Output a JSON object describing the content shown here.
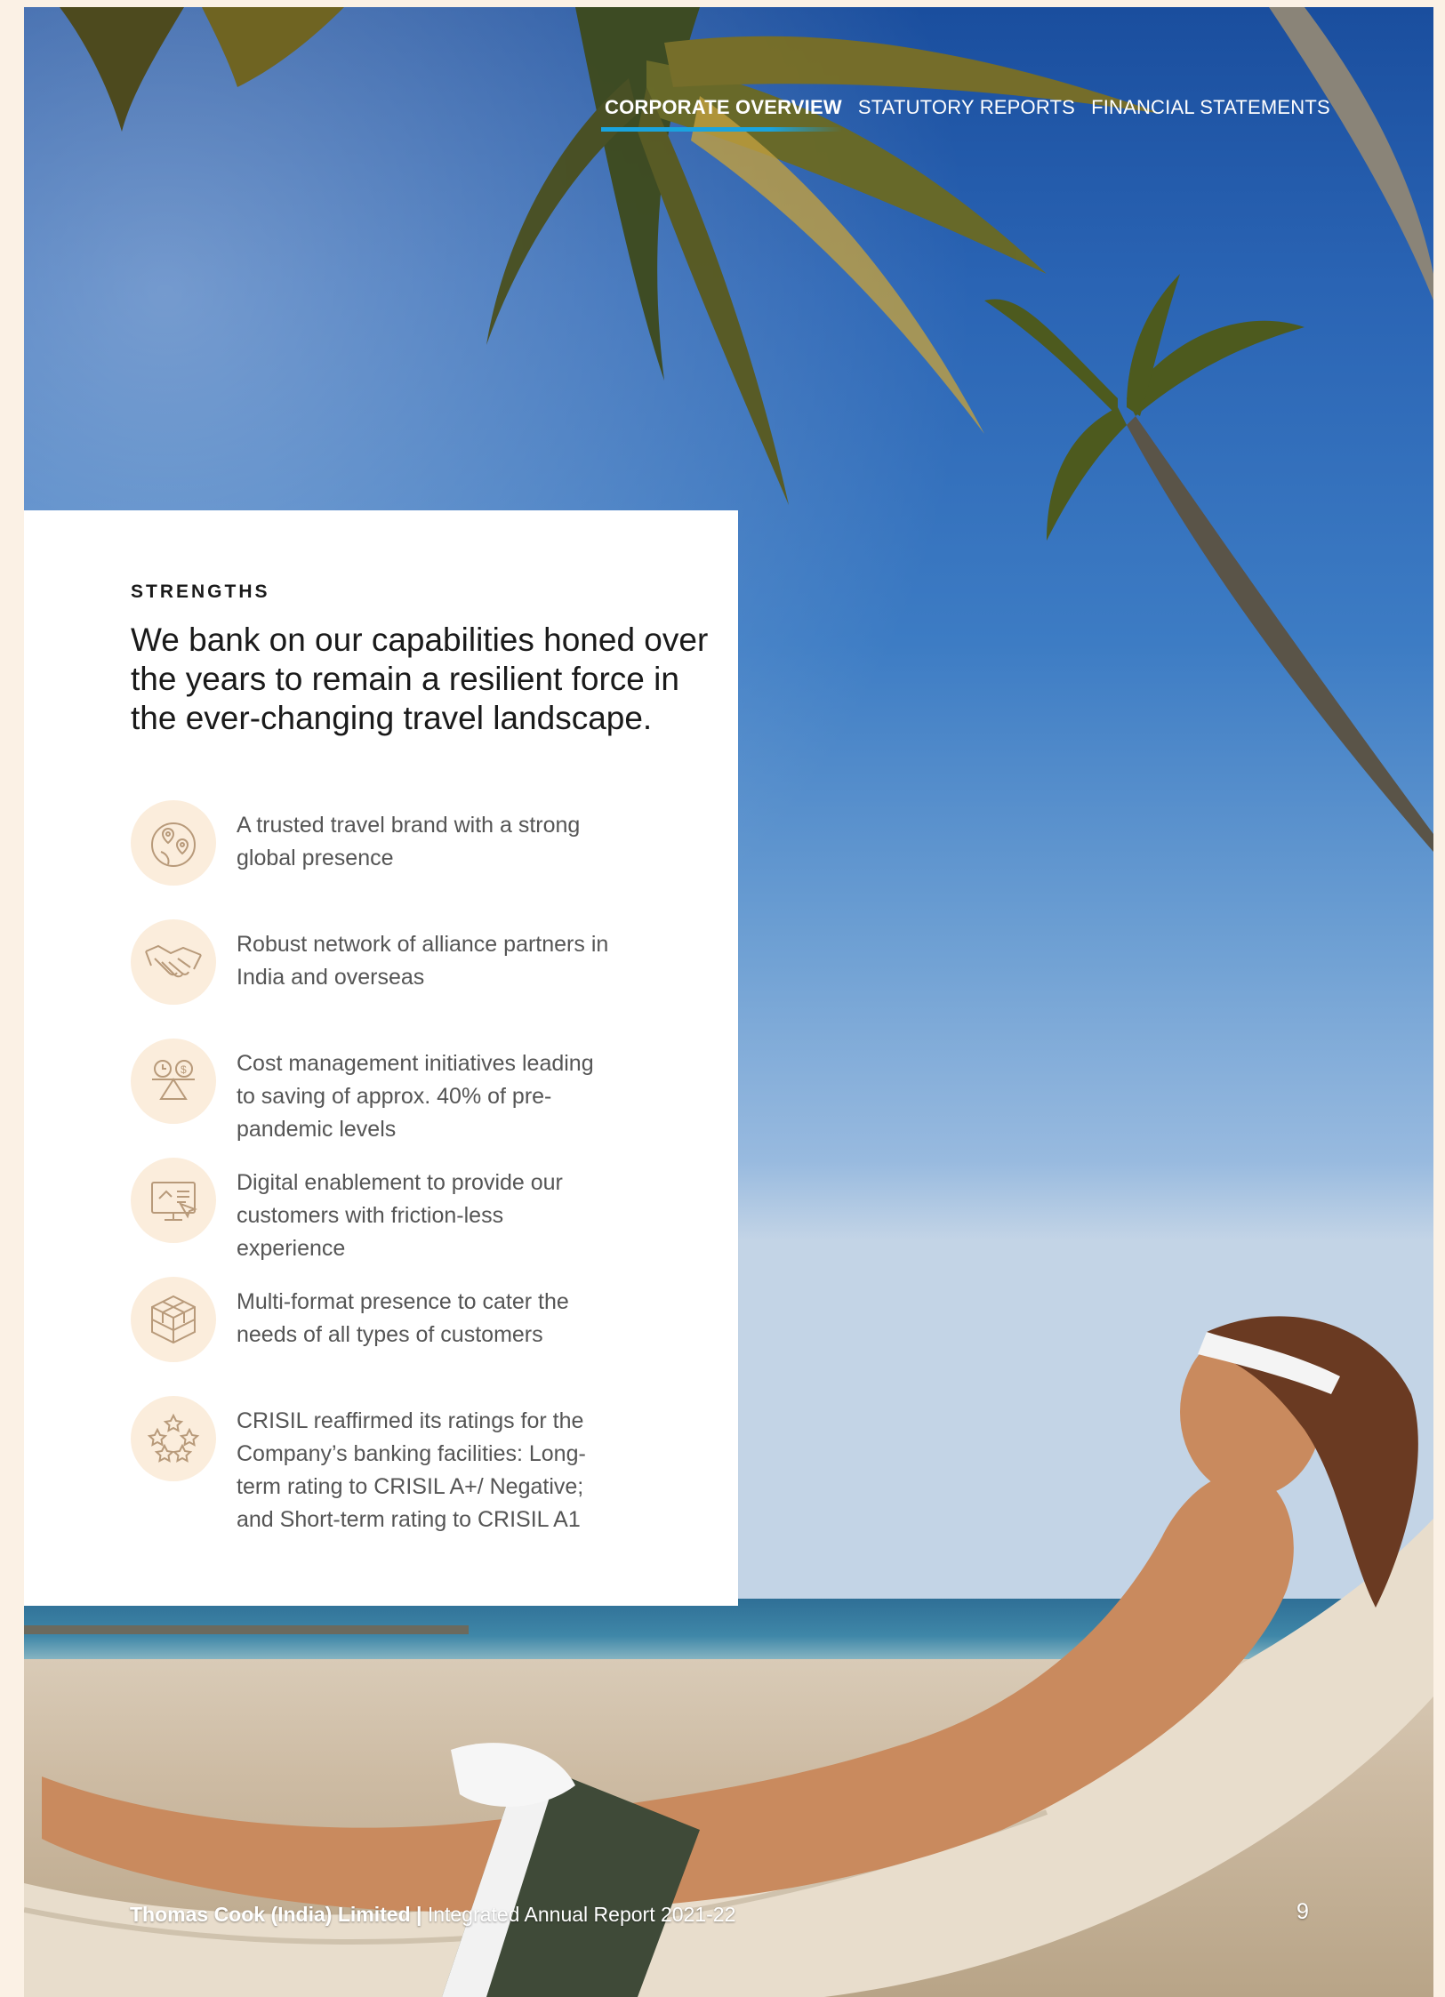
{
  "nav": {
    "items": [
      {
        "label": "CORPORATE OVERVIEW",
        "active": true
      },
      {
        "label": "STATUTORY REPORTS",
        "active": false
      },
      {
        "label": "FINANCIAL STATEMENTS",
        "active": false
      }
    ]
  },
  "panel": {
    "section_label": "STRENGTHS",
    "headline": "We bank on our capabilities honed over the years to remain a resilient force in the ever-changing travel landscape.",
    "items": [
      {
        "icon": "globe-pins-icon",
        "text": "A trusted travel brand with a strong global presence"
      },
      {
        "icon": "handshake-icon",
        "text": "Robust network of alliance partners in India and overseas"
      },
      {
        "icon": "balance-scale-icon",
        "text": "Cost management initiatives leading to saving of approx. 40% of pre-pandemic levels"
      },
      {
        "icon": "digital-screen-icon",
        "text": "Digital enablement to provide our customers with friction-less experience"
      },
      {
        "icon": "cube-icon",
        "text": "Multi-format presence to cater the needs of all types of customers"
      },
      {
        "icon": "stars-icon",
        "text": "CRISIL reaffirmed its ratings for the Company’s banking facilities: Long-term rating to CRISIL A+/ Negative; and Short-term rating to CRISIL A1"
      }
    ]
  },
  "footer": {
    "company": "Thomas Cook (India) Limited",
    "separator": "|",
    "report": "Integrated Annual Report 2021-22",
    "page_number": "9"
  },
  "colors": {
    "accent_blue": "#1aa4de",
    "icon_circle": "#fbeddc",
    "icon_stroke": "#b89a7a",
    "page_background": "#fbf1e5"
  }
}
